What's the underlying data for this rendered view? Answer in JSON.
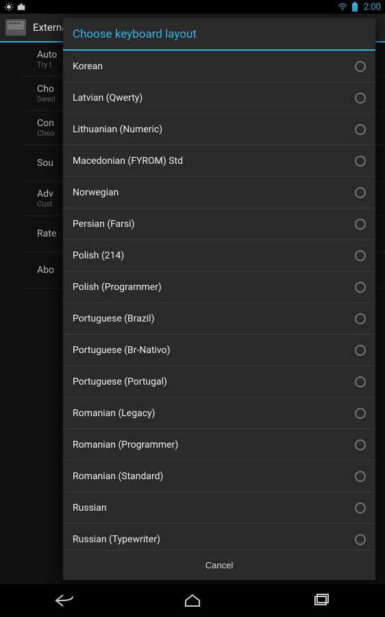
{
  "status": {
    "clock": "2:00"
  },
  "actionbar": {
    "title": "Externa"
  },
  "bg": {
    "rows": [
      {
        "t": "Auto",
        "s": "Try t"
      },
      {
        "t": "Cho",
        "s": "Swed"
      },
      {
        "t": "Con",
        "s": "Choo"
      },
      {
        "t": "Sou",
        "s": ""
      },
      {
        "t": "Adv",
        "s": "Cust"
      },
      {
        "t": "Rate",
        "s": ""
      },
      {
        "t": "Abo",
        "s": ""
      }
    ]
  },
  "dialog": {
    "title": "Choose keyboard layout",
    "cancel": "Cancel",
    "options": [
      "Korean",
      "Latvian (Qwerty)",
      "Lithuanian (Numeric)",
      "Macedonian (FYROM) Std",
      "Norwegian",
      "Persian (Farsi)",
      "Polish (214)",
      "Polish (Programmer)",
      "Portuguese (Brazil)",
      "Portuguese (Br-Nativo)",
      "Portuguese (Portugal)",
      "Romanian (Legacy)",
      "Romanian (Programmer)",
      "Romanian (Standard)",
      "Russian",
      "Russian (Typewriter)"
    ]
  }
}
